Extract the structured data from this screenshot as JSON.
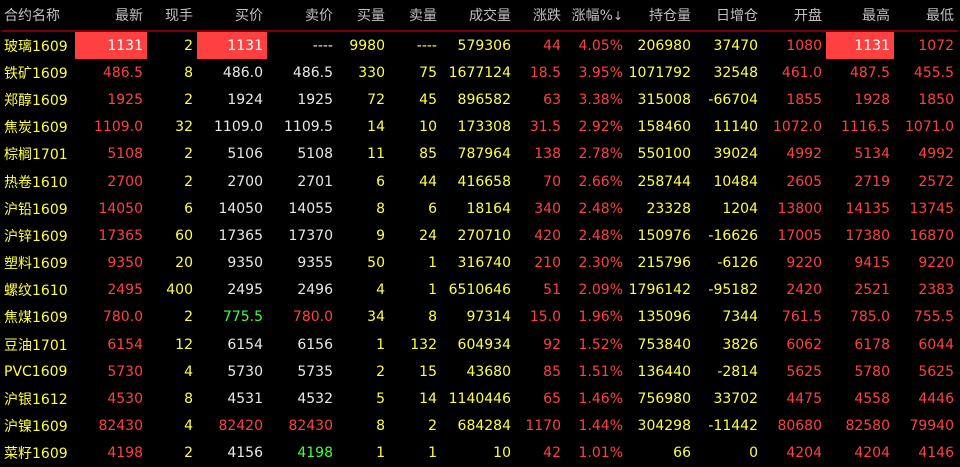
{
  "headers": [
    "合约名称",
    "最新",
    "现手",
    "买价",
    "卖价",
    "买量",
    "卖量",
    "成交量",
    "涨跌",
    "涨幅%",
    "持仓量",
    "日增仓",
    "开盘",
    "最高",
    "最低"
  ],
  "sort_indicator": "↓",
  "rows": [
    [
      "玻璃1609",
      "1131",
      "2",
      "1131",
      "----",
      "9980",
      "----",
      "579306",
      "44",
      "4.05%",
      "206980",
      "37470",
      "1080",
      "1131",
      "1072"
    ],
    [
      "铁矿1609",
      "486.5",
      "8",
      "486.0",
      "486.5",
      "330",
      "75",
      "1677124",
      "18.5",
      "3.95%",
      "1071792",
      "32548",
      "461.0",
      "487.5",
      "455.5"
    ],
    [
      "郑醇1609",
      "1925",
      "2",
      "1924",
      "1925",
      "72",
      "45",
      "896582",
      "63",
      "3.38%",
      "315008",
      "-66704",
      "1855",
      "1928",
      "1850"
    ],
    [
      "焦炭1609",
      "1109.0",
      "32",
      "1109.0",
      "1109.5",
      "14",
      "10",
      "173308",
      "31.5",
      "2.92%",
      "158460",
      "11140",
      "1072.0",
      "1116.5",
      "1071.0"
    ],
    [
      "棕榈1701",
      "5108",
      "2",
      "5106",
      "5108",
      "11",
      "85",
      "787964",
      "138",
      "2.78%",
      "550100",
      "39024",
      "4992",
      "5134",
      "4992"
    ],
    [
      "热卷1610",
      "2700",
      "2",
      "2700",
      "2701",
      "6",
      "44",
      "416658",
      "70",
      "2.66%",
      "258744",
      "10484",
      "2605",
      "2719",
      "2572"
    ],
    [
      "沪铅1609",
      "14050",
      "6",
      "14050",
      "14055",
      "8",
      "6",
      "18164",
      "340",
      "2.48%",
      "23328",
      "1204",
      "13800",
      "14135",
      "13745"
    ],
    [
      "沪锌1609",
      "17365",
      "60",
      "17365",
      "17370",
      "9",
      "24",
      "270710",
      "420",
      "2.48%",
      "150976",
      "-16626",
      "17005",
      "17380",
      "16870"
    ],
    [
      "塑料1609",
      "9350",
      "20",
      "9350",
      "9355",
      "50",
      "1",
      "316740",
      "210",
      "2.30%",
      "215796",
      "-6126",
      "9220",
      "9415",
      "9220"
    ],
    [
      "螺纹1610",
      "2495",
      "400",
      "2495",
      "2496",
      "4",
      "1",
      "6510646",
      "51",
      "2.09%",
      "1796142",
      "-95182",
      "2420",
      "2521",
      "2383"
    ],
    [
      "焦煤1609",
      "780.0",
      "2",
      "775.5",
      "780.0",
      "34",
      "8",
      "97314",
      "15.0",
      "1.96%",
      "135096",
      "7344",
      "761.5",
      "785.0",
      "755.5"
    ],
    [
      "豆油1701",
      "6154",
      "12",
      "6154",
      "6156",
      "1",
      "132",
      "604934",
      "92",
      "1.52%",
      "753840",
      "3826",
      "6062",
      "6178",
      "6044"
    ],
    [
      "PVC1609",
      "5730",
      "4",
      "5730",
      "5735",
      "2",
      "15",
      "43680",
      "85",
      "1.51%",
      "136440",
      "-2814",
      "5625",
      "5780",
      "5625"
    ],
    [
      "沪银1612",
      "4530",
      "8",
      "4531",
      "4532",
      "5",
      "14",
      "1140446",
      "65",
      "1.46%",
      "756980",
      "33702",
      "4475",
      "4558",
      "4446"
    ],
    [
      "沪镍1609",
      "82430",
      "4",
      "82420",
      "82430",
      "8",
      "2",
      "684284",
      "1170",
      "1.44%",
      "304298",
      "-11442",
      "80680",
      "82580",
      "79940"
    ],
    [
      "菜籽1609",
      "4198",
      "2",
      "4156",
      "4198",
      "1",
      "1",
      "10",
      "42",
      "1.01%",
      "66",
      "0",
      "4204",
      "4204",
      "4146"
    ]
  ],
  "colors": {
    "red": "#ff4040",
    "white": "#e8e8e8",
    "yellow": "#ffff40",
    "green": "#40ff40",
    "header": "#c0c0c0"
  }
}
